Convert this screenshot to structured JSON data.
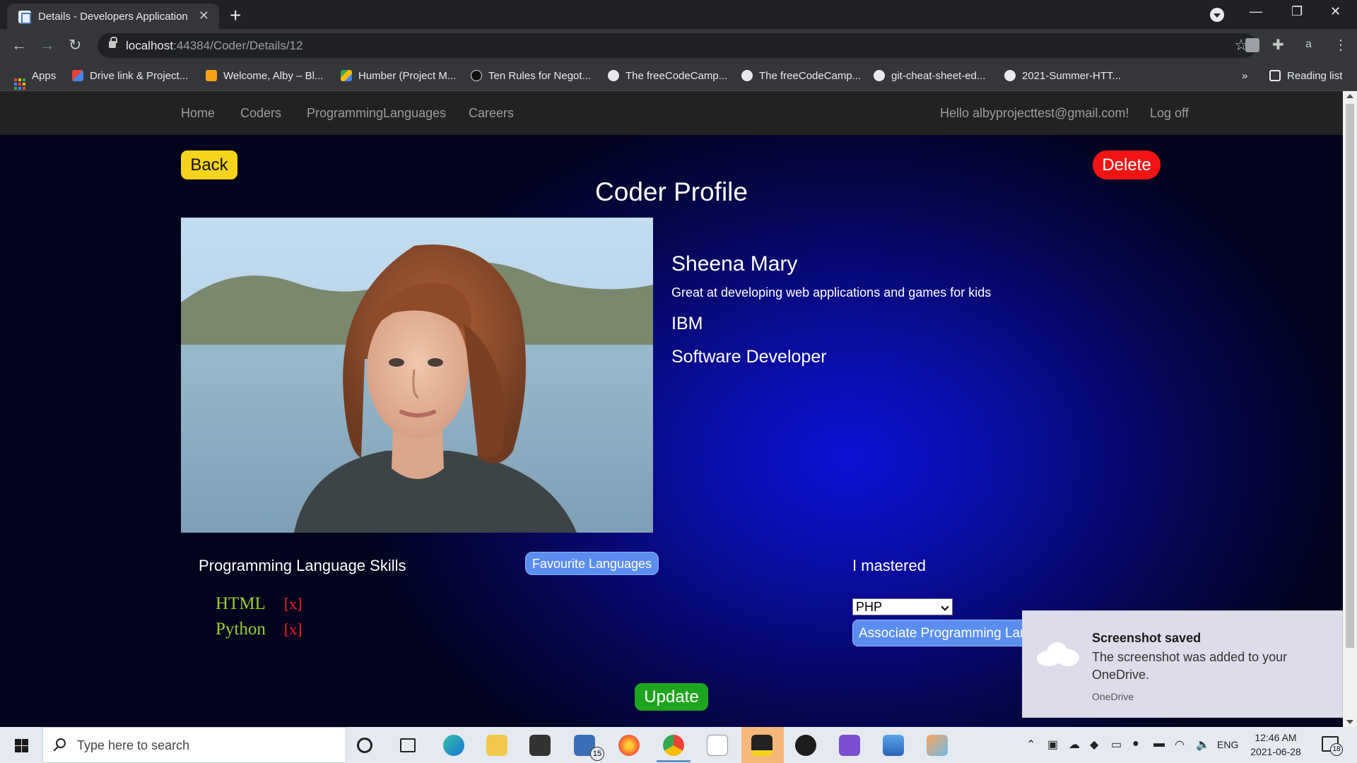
{
  "browser": {
    "tab_title": "Details - Developers Application",
    "url_host": "localhost",
    "url_rest": ":44384/Coder/Details/12",
    "profile_letter": "a",
    "bookmarks": [
      {
        "label": "Apps"
      },
      {
        "label": "Drive link & Project..."
      },
      {
        "label": "Welcome, Alby – Bl..."
      },
      {
        "label": "Humber (Project M..."
      },
      {
        "label": "Ten Rules for Negot..."
      },
      {
        "label": "The freeCodeCamp..."
      },
      {
        "label": "The freeCodeCamp..."
      },
      {
        "label": "git-cheat-sheet-ed..."
      },
      {
        "label": "2021-Summer-HTT..."
      }
    ],
    "overflow": "»",
    "reading_list": "Reading list"
  },
  "app_nav": {
    "items": [
      "Home",
      "Coders",
      "ProgrammingLanguages",
      "Careers"
    ],
    "greeting": "Hello albyprojecttest@gmail.com!",
    "logoff": "Log off"
  },
  "page": {
    "back_label": "Back",
    "delete_label": "Delete",
    "title": "Coder Profile"
  },
  "coder": {
    "name": "Sheena Mary",
    "description": "Great at developing web applications and games for kids",
    "company": "IBM",
    "job_title": "Software Developer"
  },
  "skills": {
    "heading": "Programming Language Skills",
    "favourite_button": "Favourite Languages",
    "items": [
      {
        "name": "HTML",
        "remove": "[x]"
      },
      {
        "name": "Python",
        "remove": "[x]"
      }
    ]
  },
  "mastered": {
    "heading": "I mastered",
    "selected": "PHP",
    "associate_button": "Associate Programming Language"
  },
  "update_label": "Update",
  "toast": {
    "title": "Screenshot saved",
    "body": "The screenshot was added to your OneDrive.",
    "source": "OneDrive"
  },
  "taskbar": {
    "search_placeholder": "Type here to search",
    "mail_badge": "15",
    "lang": "ENG",
    "time": "12:46 AM",
    "date": "2021-06-28",
    "notification_count": "18"
  }
}
